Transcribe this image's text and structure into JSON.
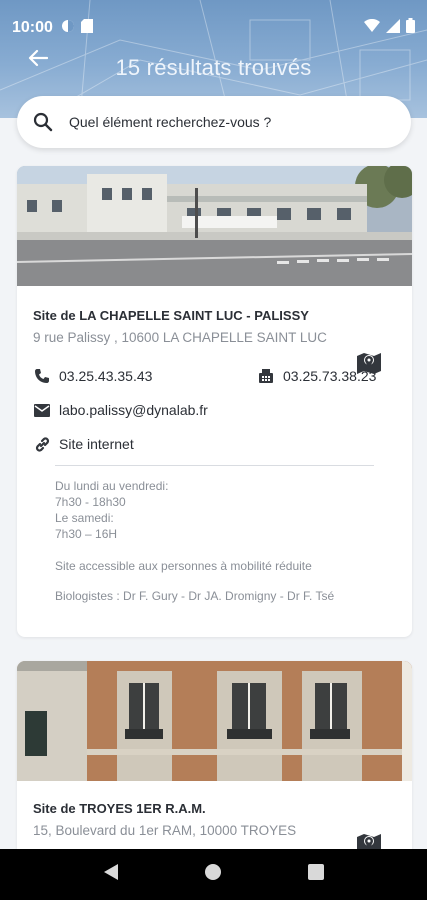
{
  "status_bar": {
    "time": "10:00",
    "icons_left": [
      "circle-app-icon",
      "sd-card-icon"
    ],
    "icons_right": [
      "wifi-icon",
      "signal-icon",
      "battery-icon"
    ]
  },
  "header": {
    "title": "15 résultats trouvés",
    "back_icon": "arrow-left-icon"
  },
  "search": {
    "placeholder": "Quel élément recherchez-vous ?",
    "icon": "search-icon"
  },
  "results": [
    {
      "title": "Site de LA CHAPELLE SAINT LUC - PALISSY",
      "address": "9 rue Palissy , 10600 LA CHAPELLE SAINT LUC",
      "phone": "03.25.43.35.43",
      "fax": "03.25.73.38.23",
      "email": "labo.palissy@dynalab.fr",
      "website_label": "Site internet",
      "hours": [
        "Du lundi au vendredi:",
        "7h30 - 18h30",
        "Le samedi:",
        "7h30 – 16H"
      ],
      "accessibility": "Site accessible aux personnes à mobilité réduite",
      "biologists": "Biologistes : Dr F. Gury - Dr JA. Dromigny - Dr F. Tsé"
    },
    {
      "title": "Site de TROYES 1ER R.A.M.",
      "address": "15, Boulevard du 1er RAM, 10000 TROYES"
    }
  ],
  "colors": {
    "header_blue": "#7ea3cc",
    "icon_dark": "#33373d",
    "text_muted": "#8a8f97"
  }
}
